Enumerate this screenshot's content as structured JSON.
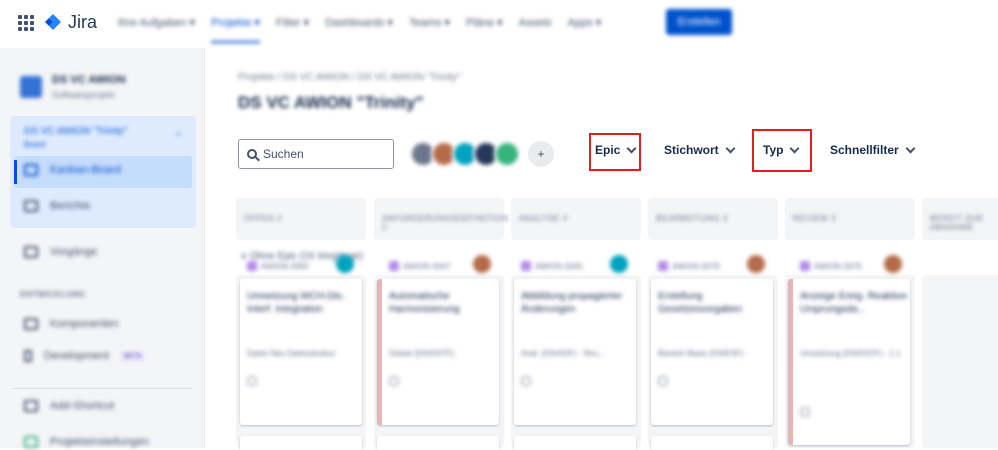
{
  "topbar": {
    "logo_text": "Jira",
    "nav": [
      "Ihre Aufgaben ▾",
      "Projekte ▾",
      "Filter ▾",
      "Dashboards ▾",
      "Teams ▾",
      "Pläne ▾",
      "Assets",
      "Apps ▾"
    ],
    "create_label": "Erstellen"
  },
  "sidebar": {
    "project_name": "DS VC AWION",
    "project_sub": "Softwareprojekt",
    "board_title": "DS VC AWION \"Trinity\"",
    "board_sub": "Board",
    "items": [
      {
        "label": "Kanban-Board"
      },
      {
        "label": "Berichte"
      },
      {
        "label": "Vorgänge"
      }
    ],
    "heading": "ENTWICKLUNG",
    "dev_items": [
      {
        "label": "Komponenten"
      },
      {
        "label": "Development",
        "badge": "BETA"
      }
    ],
    "bottom_items": [
      {
        "label": "Add-Shortcut"
      },
      {
        "label": "Projekteinstellungen"
      }
    ]
  },
  "main": {
    "breadcrumb": "Projekte / DS VC AWION / DS VC AWION \"Trinity\"",
    "title": "DS VC AWION \"Trinity\"",
    "search_placeholder": "Suchen",
    "filters": [
      "Epic",
      "Stichwort",
      "Typ",
      "Schnellfilter"
    ],
    "columns": [
      "OFFEN 2",
      "ANFORDERUNGSDEFINITION 2",
      "ANALYSE 3",
      "BEARBEITUNG 3",
      "REVIEW 3",
      "BEREIT ZUR ABNAHME"
    ],
    "swimlane": "∨ Ohne Epic  (15 Vorgänge)",
    "cards": [
      {
        "text": "Umsetzung WCH-Dis. Interf. Integration",
        "epic": "Daten Neu Datenstruktur",
        "key": "AWION-3363"
      },
      {
        "text": "Automatische Harmonisierung",
        "epic": "Global (DS/DSTF)",
        "key": "AWION-3347"
      },
      {
        "text": "Abbildung propagierter Änderungen",
        "epic": "Anal. (DS/ADF) - Stru...",
        "key": "AWION-3345"
      },
      {
        "text": "Erstellung Gesetzesvorgaben",
        "epic": "Bereich Basis (DS/ESF)",
        "key": "AWION-3378"
      },
      {
        "text": "Anzeige Ereig. Reaktion Ursprungsda...",
        "epic": "Umsetzung (DS/DSTF) - 1.1",
        "key": "AWION-3376"
      }
    ]
  },
  "colors": {
    "accent": "#0052cc",
    "highlight": "#e02020",
    "sidebar_bg": "#f4f5f7",
    "selected_bg": "#c6dcfb"
  }
}
